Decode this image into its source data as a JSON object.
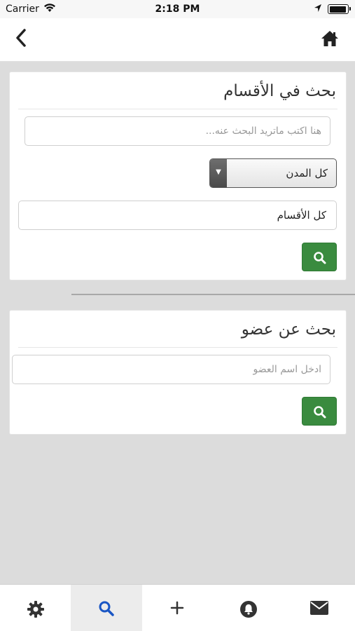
{
  "status_bar": {
    "carrier": "Carrier",
    "time": "2:18 PM"
  },
  "nav": {
    "back_icon": "chevron-left-icon",
    "home_icon": "home-icon"
  },
  "section_search": {
    "title": "بحث في الأقسام",
    "query_placeholder": "هنا اكتب ماتريد البحث عنه...",
    "city_select": "كل المدن",
    "category_select": "كل الأقسام"
  },
  "member_search": {
    "title": "بحث عن عضو",
    "name_placeholder": "ادخل اسم العضو"
  },
  "colors": {
    "search_button": "#3a8b3f",
    "active_tab_icon": "#1a56c4",
    "background": "#dcdcdc"
  },
  "tab_bar": {
    "active": "search",
    "tabs": [
      {
        "icon": "gear-icon"
      },
      {
        "icon": "search-icon"
      },
      {
        "icon": "plus-icon"
      },
      {
        "icon": "bell-icon"
      },
      {
        "icon": "mail-icon"
      }
    ]
  }
}
